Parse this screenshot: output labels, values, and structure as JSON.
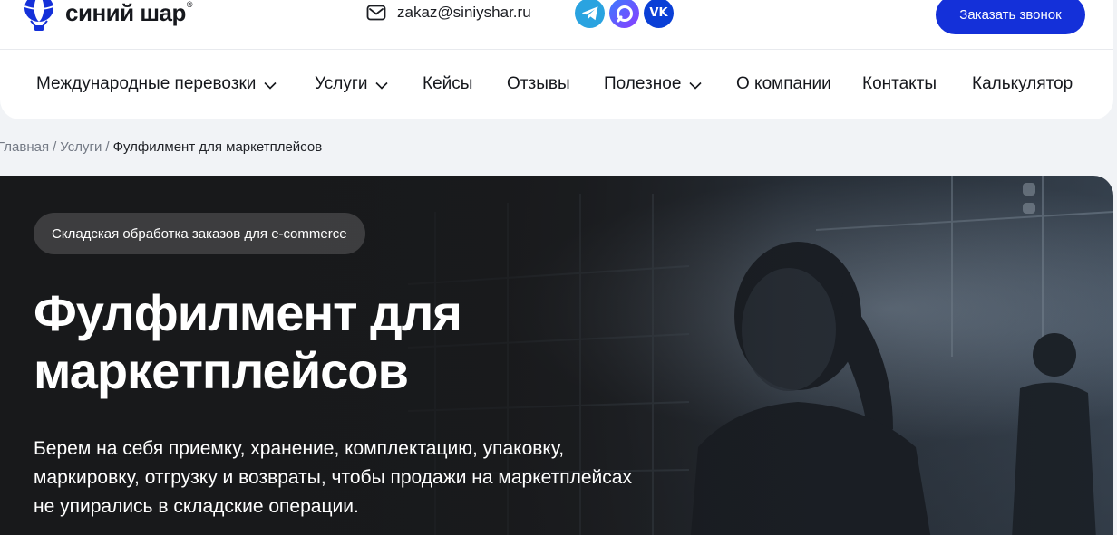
{
  "header": {
    "logo_text": "синий шар",
    "logo_mark": "®",
    "email": "zakaz@siniyshar.ru",
    "email_icon": "envelope-icon",
    "socials": [
      {
        "name": "telegram",
        "icon": "telegram-icon",
        "color": "#2aa3e0"
      },
      {
        "name": "max",
        "icon": "max-messenger-icon",
        "color": "#5a5cff"
      },
      {
        "name": "vk",
        "icon": "vk-icon",
        "label": "VK",
        "color": "#0a3fd6"
      }
    ],
    "callback_label": "Заказать звонок",
    "accent_color": "#1430d9"
  },
  "nav": {
    "items": [
      {
        "label": "Международные перевозки",
        "has_dropdown": true
      },
      {
        "label": "Услуги",
        "has_dropdown": true
      },
      {
        "label": "Кейсы",
        "has_dropdown": false
      },
      {
        "label": "Отзывы",
        "has_dropdown": false
      },
      {
        "label": "Полезное",
        "has_dropdown": true
      },
      {
        "label": "О компании",
        "has_dropdown": false
      },
      {
        "label": "Контакты",
        "has_dropdown": false
      },
      {
        "label": "Калькулятор",
        "has_dropdown": false
      }
    ]
  },
  "breadcrumb": {
    "items": [
      "Главная",
      "Услуги"
    ],
    "separator": "/",
    "current": "Фулфилмент для маркетплейсов"
  },
  "hero": {
    "badge": "Складская обработка заказов для e-commerce",
    "title_line1": "Фулфилмент для",
    "title_line2": "маркетплейсов",
    "lead_line1": "Берем на себя приемку, хранение, комплектацию, упаковку,",
    "lead_line2": "маркировку, отгрузку и возвраты, чтобы продажи на маркетплейсах",
    "lead_line3": "не упирались в складские операции."
  }
}
